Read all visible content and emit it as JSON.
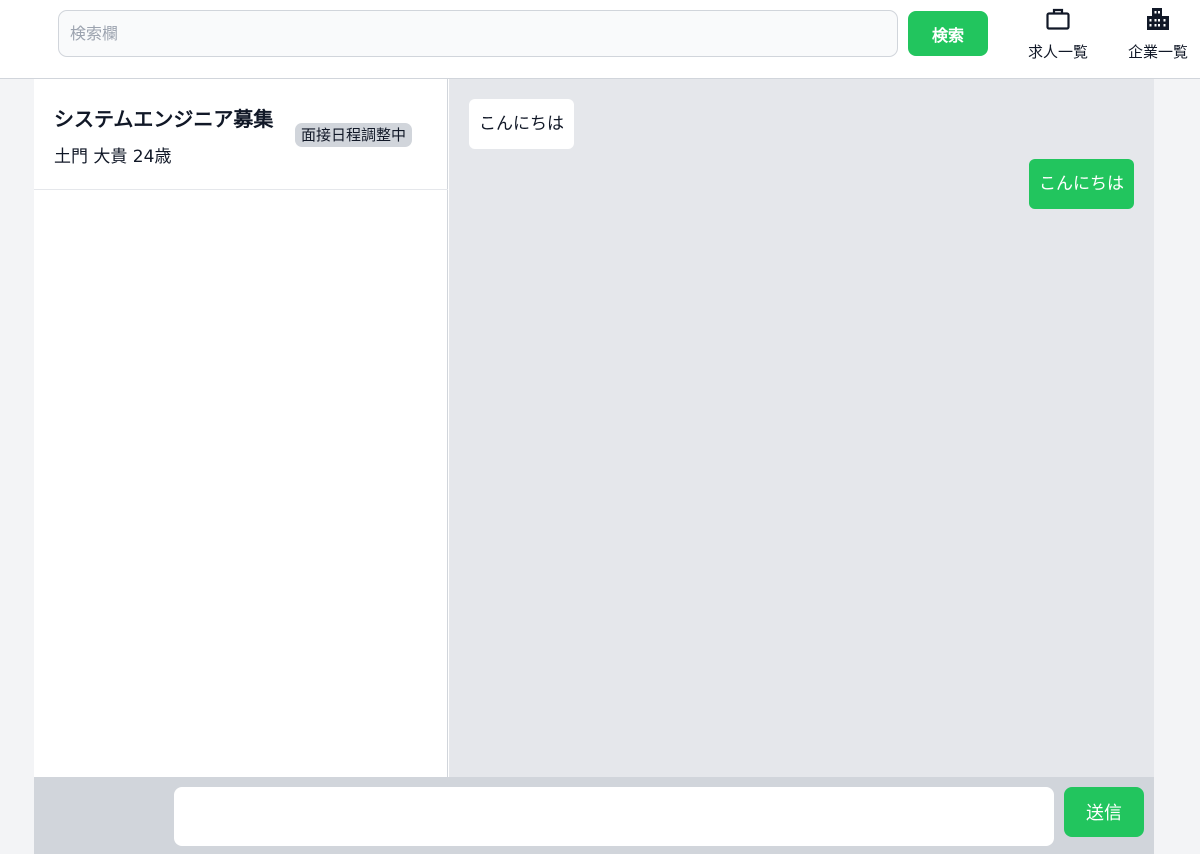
{
  "header": {
    "search": {
      "placeholder": "検索欄",
      "value": ""
    },
    "search_button_label": "検索",
    "nav": [
      {
        "label": "求人一覧",
        "icon": "briefcase-icon"
      },
      {
        "label": "企業一覧",
        "icon": "building-icon"
      }
    ]
  },
  "conversations": [
    {
      "title": "システムエンジニア募集",
      "subtitle": "土門 大貴 24歳",
      "status": "面接日程調整中"
    }
  ],
  "messages": [
    {
      "from": "other",
      "text": "こんにちは"
    },
    {
      "from": "me",
      "text": "こんにちは"
    }
  ],
  "composer": {
    "value": "",
    "send_label": "送信"
  },
  "colors": {
    "accent": "#22c55e",
    "chat_background": "#e5e7eb",
    "badge": "#d1d5db",
    "page_background": "#f3f4f6"
  }
}
